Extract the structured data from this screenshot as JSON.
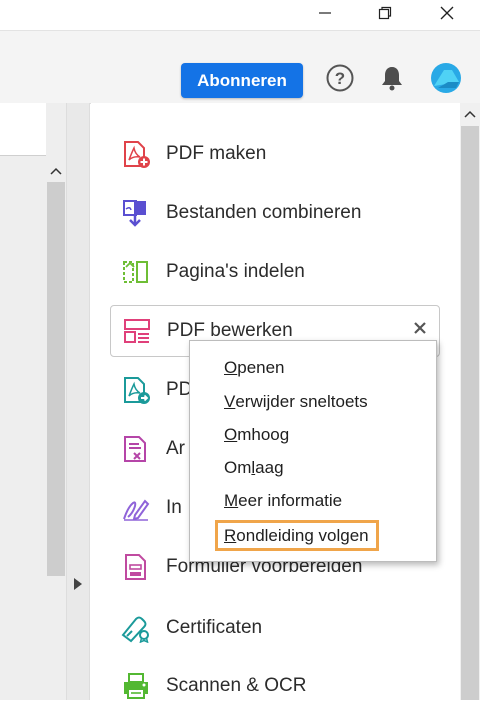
{
  "window_controls": {
    "minimize_icon": "minimize-icon",
    "restore_icon": "restore-icon",
    "close_icon": "close-icon"
  },
  "toolbar": {
    "subscribe_label": "Abonneren",
    "accent_color": "#1473e6",
    "help_icon": "help-icon",
    "bell_icon": "bell-icon",
    "avatar_icon": "avatar-icon"
  },
  "tools": [
    {
      "label": "PDF maken",
      "icon": "create-pdf-icon",
      "color": "#e0434a"
    },
    {
      "label": "Bestanden combineren",
      "icon": "combine-files-icon",
      "color": "#5a4fd1"
    },
    {
      "label": "Pagina's indelen",
      "icon": "organize-pages-icon",
      "color": "#6ebe35"
    },
    {
      "label": "PDF bewerken",
      "icon": "edit-pdf-icon",
      "color": "#e0407a"
    },
    {
      "label": "PD",
      "icon": "export-pdf-icon",
      "color": "#1b9a9a"
    },
    {
      "label": "Ar",
      "icon": "redact-icon",
      "color": "#b545a8"
    },
    {
      "label": "In",
      "icon": "fill-sign-icon",
      "color": "#8f63d9"
    },
    {
      "label": "Formulier voorbereiden",
      "icon": "prepare-form-icon",
      "color": "#c04aa0"
    },
    {
      "label": "Certificaten",
      "icon": "certificates-icon",
      "color": "#1b9a9a"
    },
    {
      "label": "Scannen & OCR",
      "icon": "scan-ocr-icon",
      "color": "#53b832"
    }
  ],
  "context_menu": {
    "items": [
      {
        "mnemonic": "O",
        "rest": "penen"
      },
      {
        "mnemonic": "V",
        "rest": "erwijder sneltoets"
      },
      {
        "mnemonic": "O",
        "rest": "mhoog"
      },
      {
        "pre": "Om",
        "mnemonic": "l",
        "rest": "aag"
      },
      {
        "mnemonic": "M",
        "rest": "eer informatie"
      },
      {
        "mnemonic": "R",
        "rest": "ondleiding volgen"
      }
    ],
    "highlight_color": "#f0a54a"
  }
}
